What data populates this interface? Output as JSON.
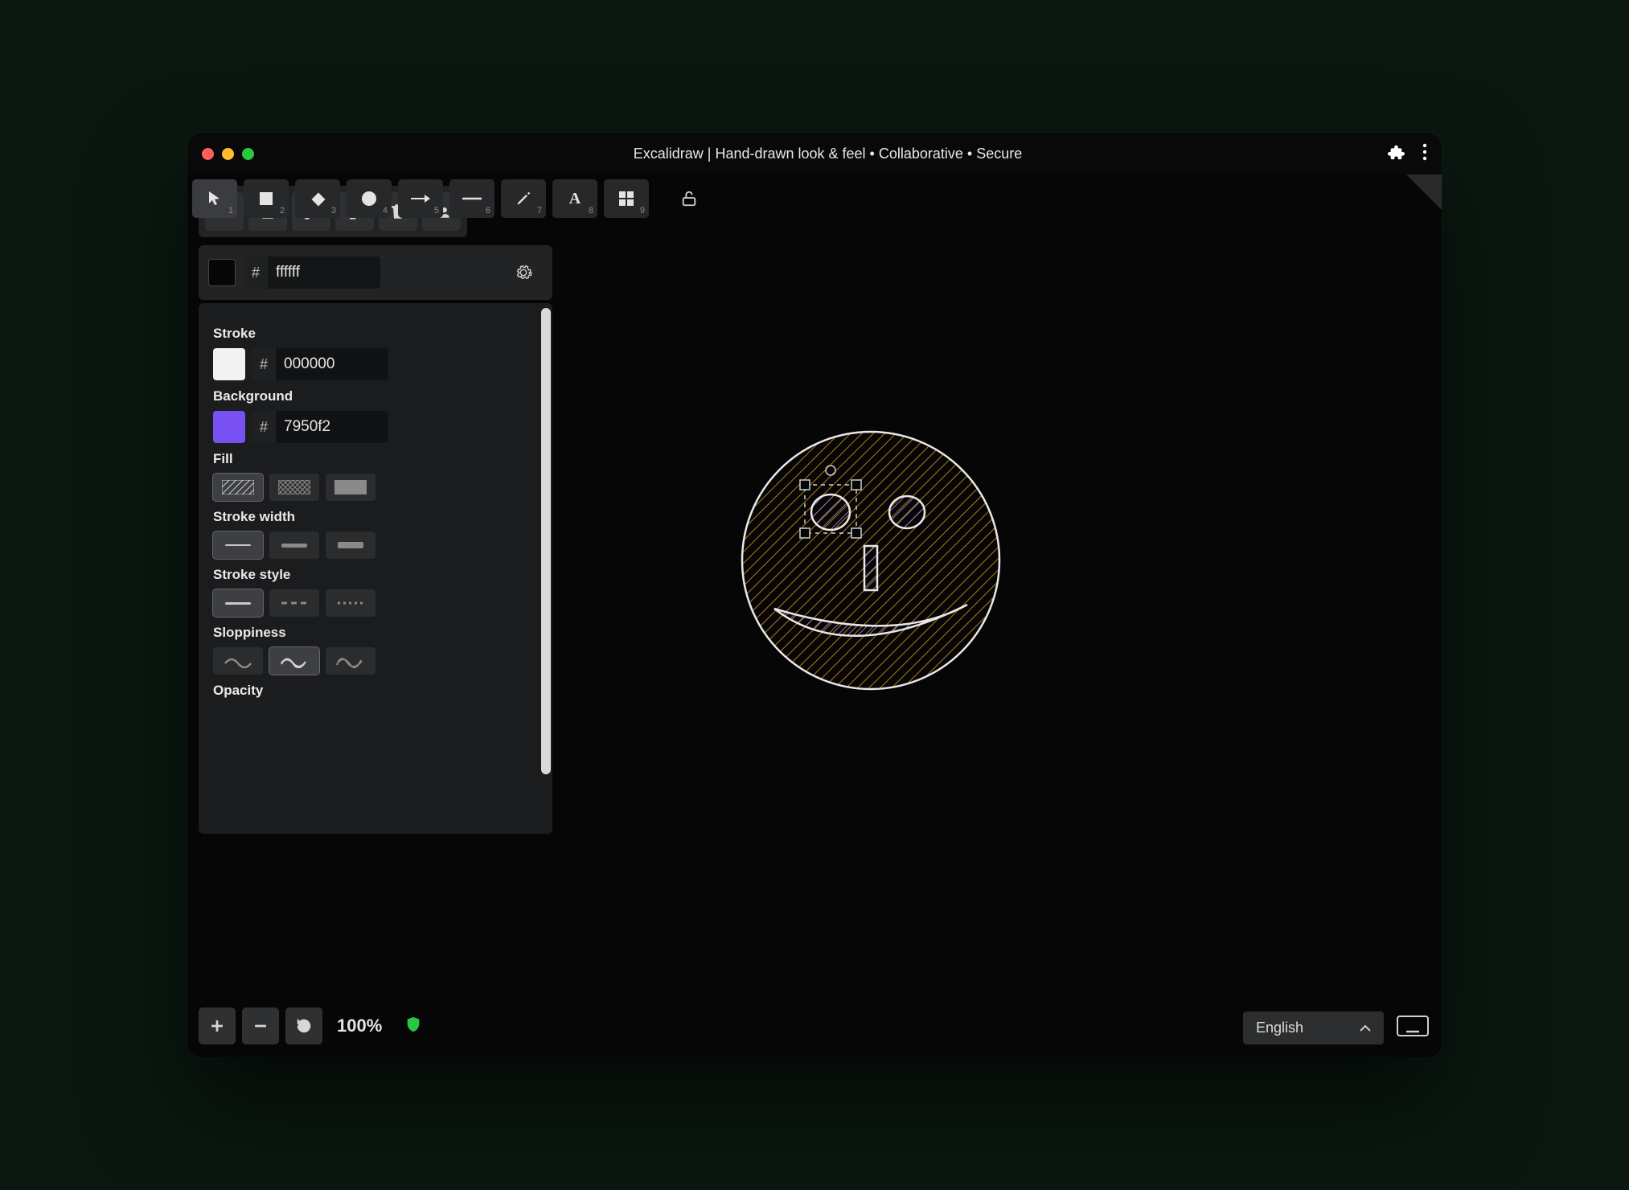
{
  "title": "Excalidraw | Hand-drawn look & feel • Collaborative • Secure",
  "canvasColor": {
    "hash": "#",
    "value": "ffffff"
  },
  "tools": [
    {
      "name": "select",
      "num": "1"
    },
    {
      "name": "rectangle",
      "num": "2"
    },
    {
      "name": "diamond",
      "num": "3"
    },
    {
      "name": "ellipse",
      "num": "4"
    },
    {
      "name": "arrow",
      "num": "5"
    },
    {
      "name": "line",
      "num": "6"
    },
    {
      "name": "pencil",
      "num": "7"
    },
    {
      "name": "text",
      "num": "8"
    },
    {
      "name": "grid",
      "num": "9"
    }
  ],
  "props": {
    "strokeLabel": "Stroke",
    "strokeValue": "000000",
    "strokeSwatch": "#f2f2f2",
    "bgLabel": "Background",
    "bgValue": "7950f2",
    "bgSwatch": "#7950f2",
    "fillLabel": "Fill",
    "strokeWidthLabel": "Stroke width",
    "strokeStyleLabel": "Stroke style",
    "sloppinessLabel": "Sloppiness",
    "opacityLabel": "Opacity",
    "hash": "#"
  },
  "footer": {
    "zoom": "100%",
    "language": "English"
  }
}
